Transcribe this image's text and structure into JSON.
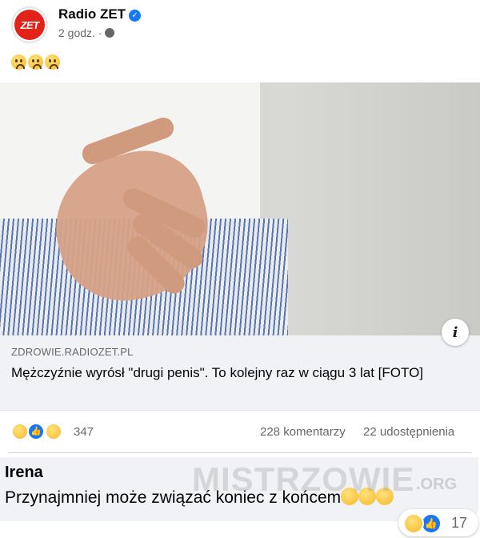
{
  "post": {
    "page_name": "Radio ZET",
    "avatar_text": "ZET",
    "time": "2 godz. ·",
    "text_emojis": [
      "sad-face",
      "sad-face",
      "sad-face"
    ]
  },
  "link": {
    "domain": "ZDROWIE.RADIOZET.PL",
    "title": "Mężczyźnie wyrósł \"drugi penis\". To kolejny raz w ciągu 3 lat [FOTO]",
    "info_glyph": "i"
  },
  "stats": {
    "reaction_icons": [
      "haha",
      "like",
      "wow"
    ],
    "reactions_count": "347",
    "comments": "228 komentarzy",
    "shares": "22 udostępnienia"
  },
  "comment": {
    "author": "Irena",
    "text": "Przynajmniej może związać koniec z końcem",
    "reactions_count": "17"
  },
  "watermark": {
    "text": "MISTRZOWIE",
    "suffix": ".ORG"
  },
  "colors": {
    "accent": "#1877f2",
    "brand_red": "#e2231a",
    "muted_text": "#65676b",
    "comment_bg": "#f0f2f5"
  }
}
